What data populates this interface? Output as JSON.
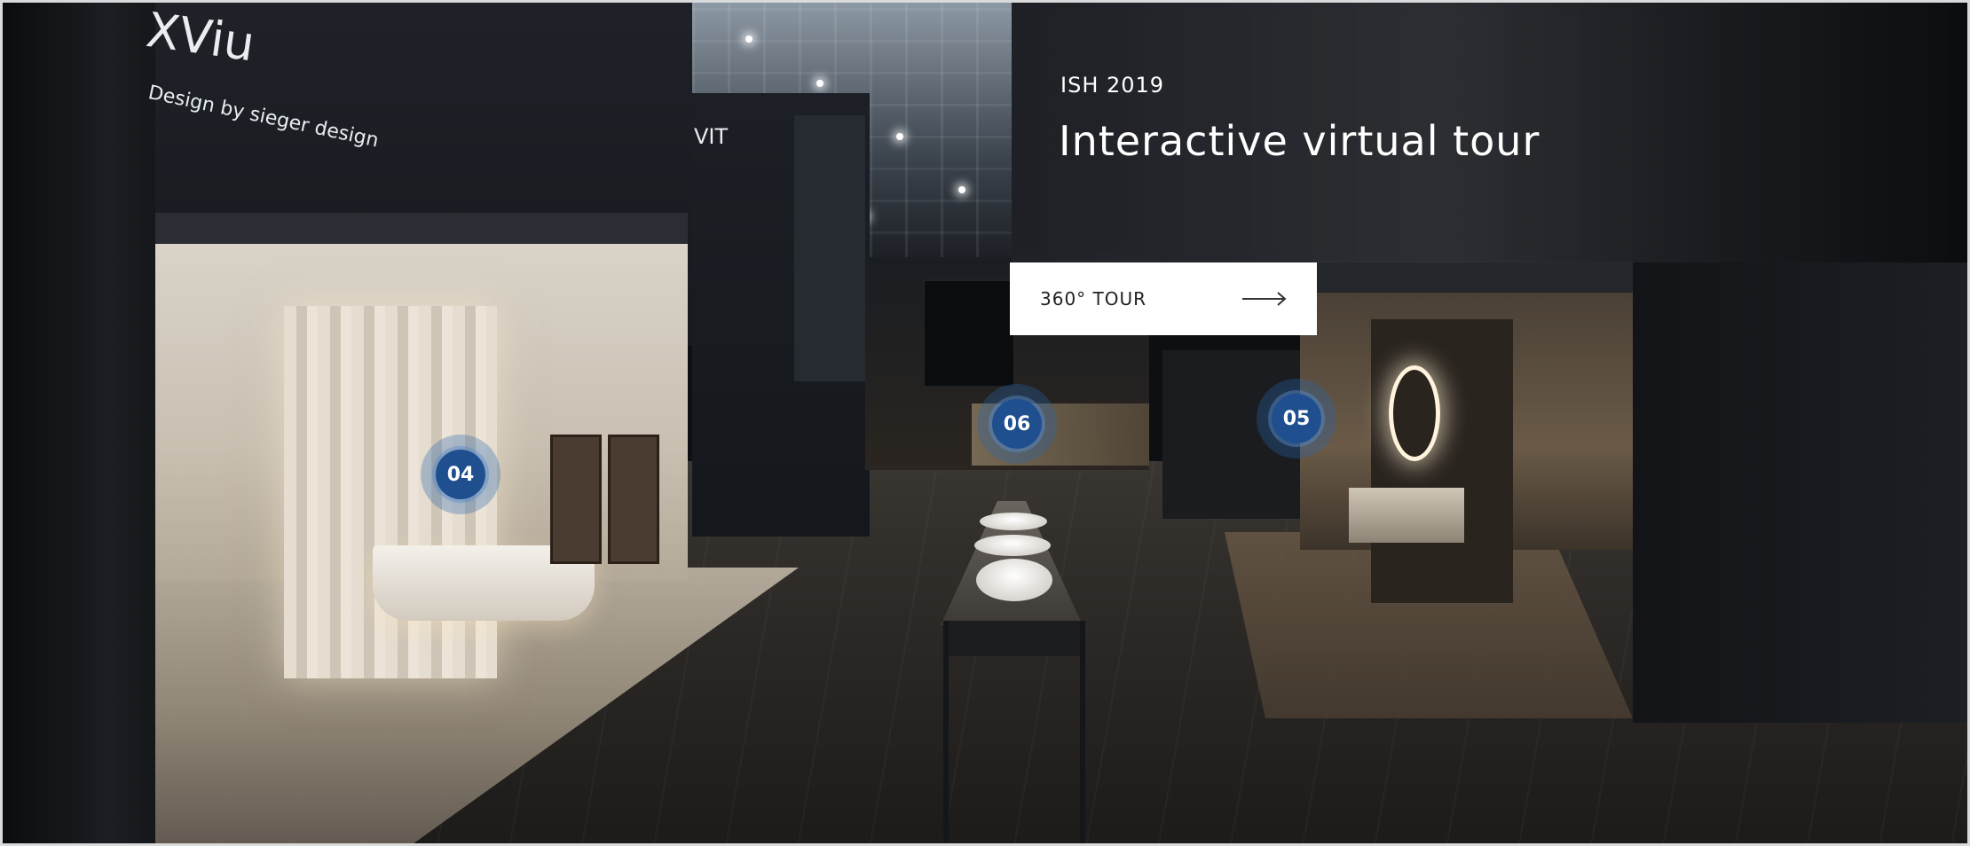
{
  "scene": {
    "sign_brand": "XViu",
    "sign_tagline": "Design by sieger design",
    "sign_mid": "VIT"
  },
  "header": {
    "eyebrow": "ISH 2019",
    "title": "Interactive virtual tour"
  },
  "cta": {
    "label": "360° TOUR",
    "icon": "arrow-right-icon"
  },
  "hotspots": [
    {
      "label": "04"
    },
    {
      "label": "06"
    },
    {
      "label": "05"
    }
  ],
  "colors": {
    "hotspot": "#1f4f8f",
    "button_bg": "#ffffff",
    "headline": "#ffffff"
  }
}
